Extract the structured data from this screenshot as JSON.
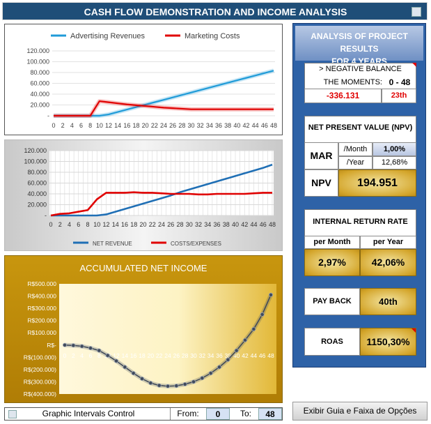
{
  "title": "CASH FLOW DEMONSTRATION AND INCOME ANALYSIS",
  "panel": {
    "heading_line1": "ANALYSIS OF PROJECT RESULTS",
    "heading_line2": "FOR 4 YEARS",
    "negative_balance": {
      "label": "> NEGATIVE BALANCE",
      "moments_label": "THE MOMENTS:",
      "moments_value": "0 - 48",
      "min_value": "-336.131",
      "min_month": "23th"
    },
    "npv": {
      "heading": "NET PRESENT VALUE (NPV)",
      "mar_label": "MAR",
      "month_label": "/Month",
      "month_value": "1,00%",
      "year_label": "/Year",
      "year_value": "12,68%",
      "npv_label": "NPV",
      "npv_value": "194.951"
    },
    "irr": {
      "heading": "INTERNAL RETURN RATE",
      "per_month_label": "per Month",
      "per_year_label": "per Year",
      "per_month_value": "2,97%",
      "per_year_value": "42,06%"
    },
    "payback": {
      "label": "PAY BACK",
      "value": "40th"
    },
    "roas": {
      "label": "ROAS",
      "value": "1150,30%"
    }
  },
  "bottom": {
    "controls_label": "Graphic Intervals Control",
    "from_label": "From:",
    "from_value": "0",
    "to_label": "To:",
    "to_value": "48",
    "guide_button": "Exibir Guia e Faixa de Opções"
  },
  "colors": {
    "title_bg": "#1f4e78",
    "panel_bg": "#2e62a7",
    "blue_series": "#1f9bd8",
    "red_series": "#e00000",
    "gold": "#c8960e"
  },
  "chart_data": [
    {
      "type": "line",
      "title": "",
      "x": [
        0,
        2,
        4,
        6,
        8,
        10,
        12,
        14,
        16,
        18,
        20,
        22,
        24,
        26,
        28,
        30,
        32,
        34,
        36,
        38,
        40,
        42,
        44,
        46,
        48
      ],
      "ylim": [
        0,
        120000
      ],
      "yticks": [
        "-",
        "20.000",
        "40.000",
        "60.000",
        "80.000",
        "100.000",
        "120.000"
      ],
      "legend": "top",
      "series": [
        {
          "name": "Advertising Revenues",
          "color": "#1f9bd8",
          "values": [
            0,
            0,
            0,
            0,
            0,
            0,
            2500,
            7000,
            11500,
            16000,
            20500,
            25000,
            29500,
            34000,
            38500,
            43000,
            47500,
            52000,
            56500,
            61000,
            65500,
            70000,
            74500,
            79000,
            83500
          ]
        },
        {
          "name": "Marketing Costs",
          "color": "#e00000",
          "values": [
            0,
            0,
            0,
            0,
            0,
            27000,
            25000,
            23000,
            21000,
            19500,
            18000,
            16500,
            15000,
            14000,
            13000,
            12000,
            12000,
            12000,
            12000,
            12000,
            12000,
            12000,
            12000,
            12000,
            12000
          ]
        }
      ]
    },
    {
      "type": "line",
      "title": "",
      "x": [
        0,
        2,
        4,
        6,
        8,
        10,
        12,
        14,
        16,
        18,
        20,
        22,
        24,
        26,
        28,
        30,
        32,
        34,
        36,
        38,
        40,
        42,
        44,
        46,
        48
      ],
      "ylim": [
        0,
        120000
      ],
      "yticks": [
        "-",
        "20.000",
        "40.000",
        "60.000",
        "80.000",
        "100.000",
        "120.000"
      ],
      "legend": "bottom",
      "series": [
        {
          "name": "NET REVENUE",
          "color": "#1f6fb5",
          "values": [
            0,
            0,
            0,
            0,
            0,
            0,
            2000,
            7000,
            12000,
            17000,
            22000,
            27000,
            32000,
            37000,
            43000,
            48000,
            53000,
            58000,
            63000,
            68000,
            73000,
            78000,
            83000,
            88000,
            94000
          ]
        },
        {
          "name": "COSTS/EXPENSES",
          "color": "#e00000",
          "values": [
            0,
            3000,
            4000,
            7000,
            10000,
            30000,
            42000,
            42000,
            42000,
            43000,
            42000,
            42000,
            41000,
            40000,
            40000,
            40000,
            39000,
            39000,
            40000,
            40000,
            40000,
            40000,
            41000,
            42000,
            42000
          ]
        }
      ]
    },
    {
      "type": "line",
      "title": "ACCUMULATED NET INCOME",
      "x": [
        0,
        2,
        4,
        6,
        8,
        10,
        12,
        14,
        16,
        18,
        20,
        22,
        24,
        26,
        28,
        30,
        32,
        34,
        36,
        38,
        40,
        42,
        44,
        46,
        48
      ],
      "ylim": [
        -400000,
        500000
      ],
      "yticks": [
        "R$(400.000)",
        "R$(300.000)",
        "R$(200.000)",
        "R$(100.000)",
        "R$-",
        "R$100.000",
        "R$200.000",
        "R$300.000",
        "R$400.000",
        "R$500.000"
      ],
      "series": [
        {
          "name": "",
          "color": "#404a5a",
          "values": [
            0,
            -3000,
            -10000,
            -25000,
            -45000,
            -85000,
            -130000,
            -180000,
            -230000,
            -275000,
            -310000,
            -330000,
            -336131,
            -333000,
            -320000,
            -300000,
            -270000,
            -230000,
            -180000,
            -120000,
            -45000,
            40000,
            130000,
            250000,
            410000
          ]
        }
      ]
    }
  ]
}
